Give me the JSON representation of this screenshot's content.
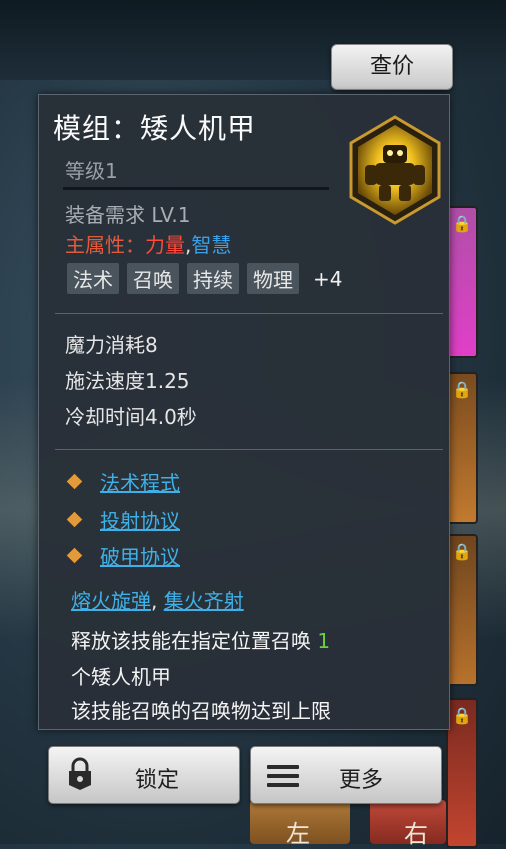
{
  "header": {
    "price_button": "查价"
  },
  "item": {
    "title": "模组：矮人机甲",
    "level": "等级1",
    "requirement": "装备需求 LV.1",
    "main_attr_label": "主属性：",
    "main_attr_strength": "力量",
    "main_attr_separator": ",",
    "main_attr_intellect": "智慧",
    "tags": [
      "法术",
      "召唤",
      "持续",
      "物理"
    ],
    "tags_more": "+4",
    "stats": [
      "魔力消耗8",
      "施法速度1.25",
      "冷却时间4.0秒"
    ],
    "protocols": [
      "法术程式",
      "投射协议",
      "破甲协议"
    ],
    "combo_1": "熔火旋弹",
    "combo_sep": ", ",
    "combo_2": "集火齐射",
    "desc_line1_prefix": "释放该技能在指定位置召唤 ",
    "desc_line1_number": "1",
    "desc_line2": "个矮人机甲",
    "desc_line3": "该技能召唤的召唤物达到上限",
    "icon": "dwarf-mech-emblem"
  },
  "actions": {
    "lock_label": "锁定",
    "more_label": "更多"
  },
  "background": {
    "card_left_label": "左",
    "card_right_label": "右"
  },
  "colors": {
    "strength": "#ff4a3a",
    "intellect": "#3aa0e8",
    "link": "#3fb1e8",
    "number_highlight": "#6bd23f",
    "bullet": "#e39a3a"
  }
}
